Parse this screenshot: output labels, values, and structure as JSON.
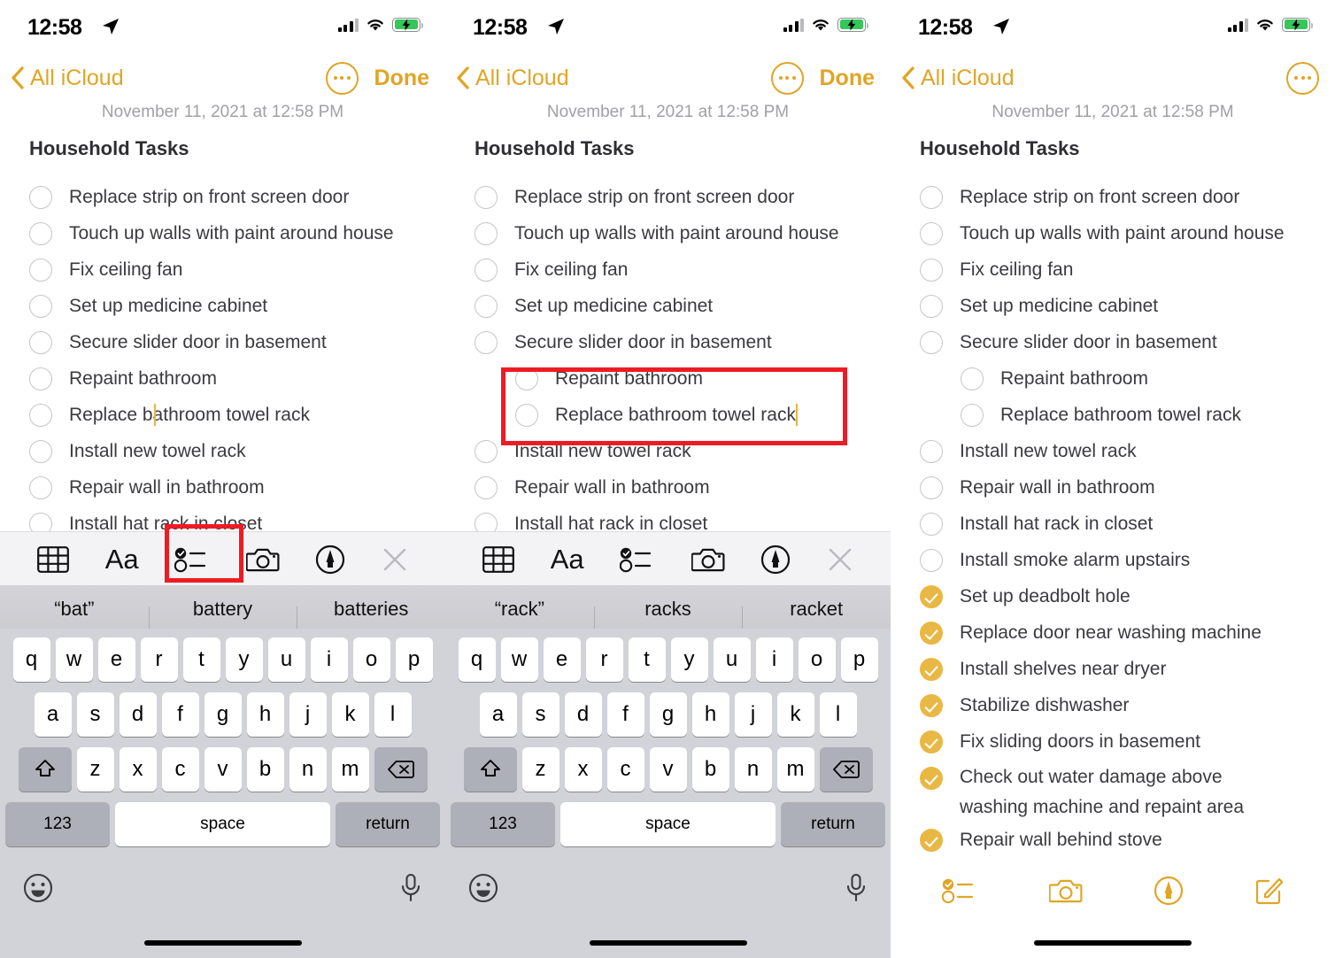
{
  "status_bar": {
    "time": "12:58",
    "location_icon": "location-arrow-icon",
    "signal_icon": "cellular-signal-icon",
    "wifi_icon": "wifi-icon",
    "battery_icon": "battery-charging-icon"
  },
  "nav": {
    "back_label": "All iCloud",
    "back_icon": "chevron-left-icon",
    "more_icon": "ellipsis-circle-icon",
    "done_label": "Done"
  },
  "note": {
    "date": "November 11, 2021 at 12:58 PM",
    "title": "Household Tasks"
  },
  "checklist": [
    {
      "label": "Replace strip on front screen door",
      "checked": false,
      "indent": false
    },
    {
      "label": "Touch up walls with paint around house",
      "checked": false,
      "indent": false
    },
    {
      "label": "Fix ceiling fan",
      "checked": false,
      "indent": false
    },
    {
      "label": "Set up medicine cabinet",
      "checked": false,
      "indent": false
    },
    {
      "label": "Secure slider door in basement",
      "checked": false,
      "indent": false
    },
    {
      "label": "Repaint bathroom",
      "checked": false,
      "indent": false
    },
    {
      "label": "Replace bathroom towel rack",
      "checked": false,
      "indent": false
    },
    {
      "label": "Install new towel rack",
      "checked": false,
      "indent": false
    },
    {
      "label": "Repair wall in bathroom",
      "checked": false,
      "indent": false
    },
    {
      "label": "Install hat rack in closet",
      "checked": false,
      "indent": false
    },
    {
      "label": "Install smoke alarm upstairs",
      "checked": false,
      "indent": false
    },
    {
      "label": "Set up deadbolt hole",
      "checked": true,
      "indent": false
    },
    {
      "label": "Replace door near washing machine",
      "checked": true,
      "indent": false
    },
    {
      "label": "Install shelves near dryer",
      "checked": true,
      "indent": false
    },
    {
      "label": "Stabilize dishwasher",
      "checked": true,
      "indent": false
    },
    {
      "label": "Fix sliding doors in basement",
      "checked": true,
      "indent": false
    },
    {
      "label": "Check out water damage above washing machine and repaint area",
      "checked": true,
      "indent": false
    },
    {
      "label": "Repair wall behind stove",
      "checked": true,
      "indent": false
    }
  ],
  "panel1": {
    "rows": [
      "Replace strip on front screen door",
      "Touch up walls with paint around house",
      "Fix ceiling fan",
      "Set up medicine cabinet",
      "Secure slider door in basement",
      "Repaint bathroom",
      "Replace bathroom towel rack",
      "Install new towel rack",
      "Repair wall in bathroom"
    ],
    "caret_row_index": 6,
    "predictions": [
      "“bat”",
      "battery",
      "batteries"
    ],
    "highlight_target": "checklist-format-icon"
  },
  "panel2": {
    "rows": [
      "Replace strip on front screen door",
      "Touch up walls with paint around house",
      "Fix ceiling fan",
      "Set up medicine cabinet",
      "Secure slider door in basement",
      "Repaint bathroom",
      "Replace bathroom towel rack",
      "Install new towel rack",
      "Repair wall in bathroom"
    ],
    "indented_rows": [
      5,
      6
    ],
    "caret_row_index": 6,
    "predictions": [
      "“rack”",
      "racks",
      "racket"
    ],
    "highlight_target": "indented-checklist-rows"
  },
  "panel3": {
    "rows": [
      {
        "label": "Replace strip on front screen door",
        "checked": false,
        "indent": false
      },
      {
        "label": "Touch up walls with paint around house",
        "checked": false,
        "indent": false
      },
      {
        "label": "Fix ceiling fan",
        "checked": false,
        "indent": false
      },
      {
        "label": "Set up medicine cabinet",
        "checked": false,
        "indent": false
      },
      {
        "label": "Secure slider door in basement",
        "checked": false,
        "indent": false
      },
      {
        "label": "Repaint bathroom",
        "checked": false,
        "indent": true
      },
      {
        "label": "Replace bathroom towel rack",
        "checked": false,
        "indent": true
      },
      {
        "label": "Install new towel rack",
        "checked": false,
        "indent": false
      },
      {
        "label": "Repair wall in bathroom",
        "checked": false,
        "indent": false
      },
      {
        "label": "Install hat rack in closet",
        "checked": false,
        "indent": false
      },
      {
        "label": "Install smoke alarm upstairs",
        "checked": false,
        "indent": false
      },
      {
        "label": "Set up deadbolt hole",
        "checked": true,
        "indent": false
      },
      {
        "label": "Replace door near washing machine",
        "checked": true,
        "indent": false
      },
      {
        "label": "Install shelves near dryer",
        "checked": true,
        "indent": false
      },
      {
        "label": "Stabilize dishwasher",
        "checked": true,
        "indent": false
      },
      {
        "label": "Fix sliding doors in basement",
        "checked": true,
        "indent": false
      },
      {
        "label": "Check out water damage above washing machine and repaint area",
        "checked": true,
        "indent": false,
        "two_line": true
      },
      {
        "label": "Repair wall behind stove",
        "checked": true,
        "indent": false
      }
    ],
    "bottom_icons": [
      "checklist-icon",
      "camera-icon",
      "markup-pen-icon",
      "compose-icon"
    ]
  },
  "format_toolbar": {
    "icons": [
      "table-icon",
      "text-format-icon",
      "checklist-icon",
      "camera-icon",
      "markup-pen-icon",
      "close-icon"
    ],
    "text_format_label": "Aa"
  },
  "keyboard": {
    "row1": [
      "q",
      "w",
      "e",
      "r",
      "t",
      "y",
      "u",
      "i",
      "o",
      "p"
    ],
    "row2": [
      "a",
      "s",
      "d",
      "f",
      "g",
      "h",
      "j",
      "k",
      "l"
    ],
    "row3": [
      "z",
      "x",
      "c",
      "v",
      "b",
      "n",
      "m"
    ],
    "shift_icon": "shift-arrow-icon",
    "backspace_icon": "backspace-icon",
    "numbers_label": "123",
    "space_label": "space",
    "return_label": "return",
    "emoji_icon": "emoji-smiley-icon",
    "mic_icon": "microphone-icon"
  },
  "colors": {
    "accent": "#e0a526",
    "check_fill": "#e9b844",
    "annotation": "#ed1c24",
    "battery_green": "#34c759"
  }
}
